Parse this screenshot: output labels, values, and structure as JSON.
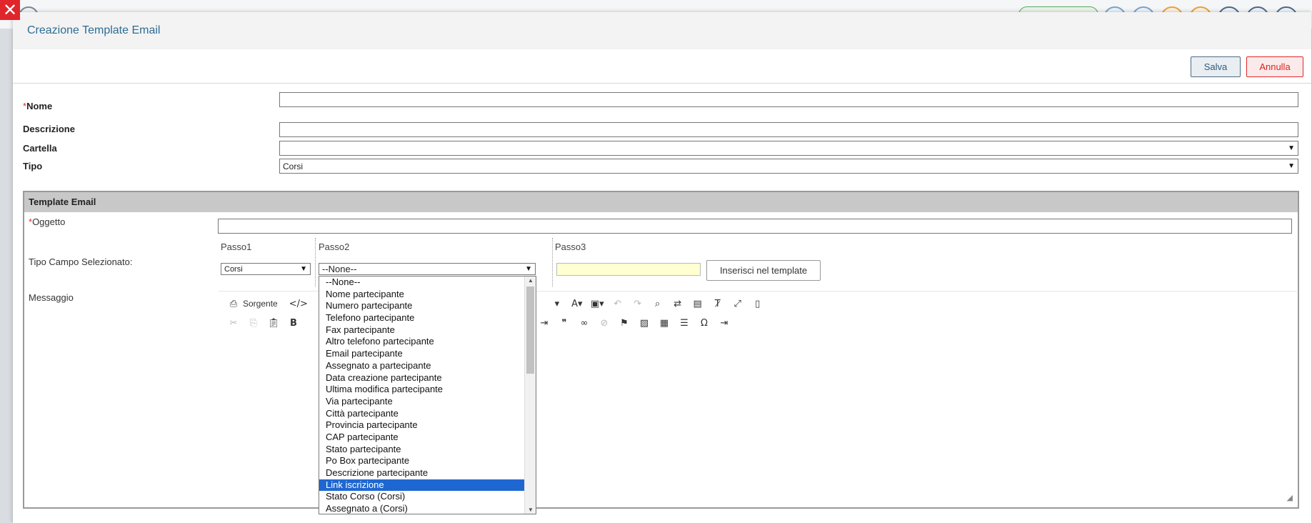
{
  "modal": {
    "title": "Creazione Template Email",
    "save_label": "Salva",
    "cancel_label": "Annulla",
    "close_icon": "close-icon"
  },
  "form": {
    "required_mark": "*",
    "name_label": "Nome",
    "name_value": "",
    "description_label": "Descrizione",
    "description_value": "",
    "folder_label": "Cartella",
    "folder_value": "",
    "type_label": "Tipo",
    "type_value": "Corsi"
  },
  "template": {
    "section_title": "Template Email",
    "subject_label": "Oggetto",
    "subject_value": "",
    "field_type_label": "Tipo Campo Selezionato:",
    "step1_label": "Passo1",
    "step2_label": "Passo2",
    "step3_label": "Passo3",
    "step1_value": "Corsi",
    "step2_value": "--None--",
    "step3_value": "",
    "insert_button": "Inserisci nel template",
    "message_label": "Messaggio"
  },
  "editor": {
    "source_label": "Sorgente"
  },
  "dropdown": {
    "options": [
      "--None--",
      "Nome partecipante",
      "Numero partecipante",
      "Telefono partecipante",
      "Fax partecipante",
      "Altro telefono partecipante",
      "Email partecipante",
      "Assegnato a partecipante",
      "Data creazione partecipante",
      "Ultima modifica partecipante",
      "Via partecipante",
      "Città partecipante",
      "Provincia partecipante",
      "CAP partecipante",
      "Stato partecipante",
      "Po Box partecipante",
      "Descrizione partecipante",
      "Link iscrizione",
      "Stato Corso (Corsi)",
      "Assegnato a (Corsi)"
    ],
    "highlighted": "Link iscrizione"
  },
  "colors": {
    "accent": "#2e6d95",
    "danger": "#e0262b",
    "highlight": "#1e67d0"
  }
}
